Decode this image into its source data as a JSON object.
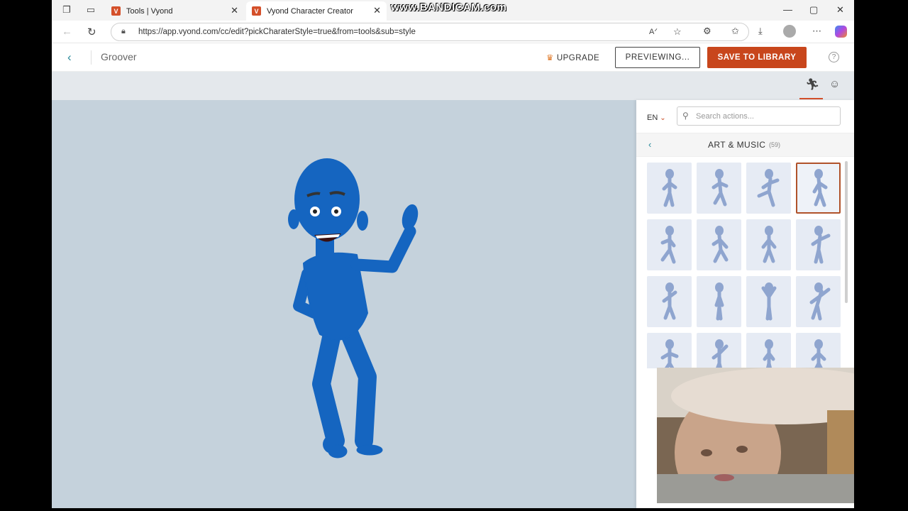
{
  "browser": {
    "tabs": [
      {
        "label": "Tools | Vyond",
        "favicon": "V",
        "active": false
      },
      {
        "label": "Vyond Character Creator",
        "favicon": "V",
        "active": true
      }
    ],
    "tab_close": "✕",
    "url": "https://app.vyond.com/cc/edit?pickCharaterStyle=true&from=tools&sub=style",
    "window_controls": [
      "—",
      "▢",
      "✕"
    ]
  },
  "watermark": "www.BANDICAM.com",
  "app": {
    "character_name": "Groover",
    "upgrade_label": "UPGRADE",
    "preview_label": "PREVIEWING...",
    "save_label": "SAVE TO LIBRARY",
    "help_label": "?"
  },
  "panel": {
    "language": "EN",
    "search_placeholder": "Search actions...",
    "category": "ART & MUSIC",
    "category_count": "(59)",
    "selected_index": 3,
    "action_count_visible": 16
  },
  "colors": {
    "accent": "#c8461c",
    "teal": "#2a8a9a",
    "character": "#1565c0",
    "canvas": "#c5d2dc",
    "thumb_figure": "#8fa5cf"
  },
  "icons": {
    "action": "running-figure-icon",
    "face": "face-mask-icon",
    "crown": "crown-icon"
  }
}
